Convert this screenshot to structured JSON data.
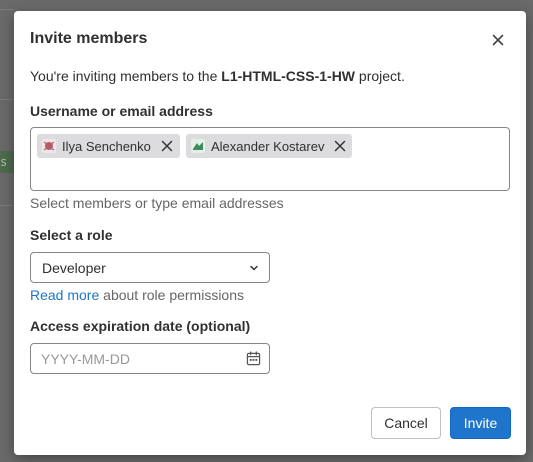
{
  "background": {
    "fragment_text": "s f"
  },
  "modal": {
    "title": "Invite members",
    "intro": {
      "prefix": "You're inviting members to the ",
      "project": "L1-HTML-CSS-1-HW",
      "suffix": " project."
    },
    "members": {
      "label": "Username or email address",
      "tokens": [
        {
          "name": "Ilya Senchenko",
          "avatar_color": "#b85a6a"
        },
        {
          "name": "Alexander Kostarev",
          "avatar_color": "#3f8a5a"
        }
      ],
      "help": "Select members or type email addresses"
    },
    "role": {
      "label": "Select a role",
      "selected": "Developer",
      "help_link": "Read more",
      "help_text": " about role permissions"
    },
    "expiration": {
      "label": "Access expiration date (optional)",
      "placeholder": "YYYY-MM-DD",
      "value": ""
    },
    "footer": {
      "cancel_label": "Cancel",
      "invite_label": "Invite"
    }
  },
  "colors": {
    "primary": "#1f75cb",
    "text": "#303030",
    "muted": "#666666",
    "token_bg": "#dcdcde"
  },
  "icons": {
    "close": "close-icon",
    "remove_token": "close-icon",
    "select_chevron": "chevron-down-icon",
    "calendar": "calendar-icon"
  }
}
